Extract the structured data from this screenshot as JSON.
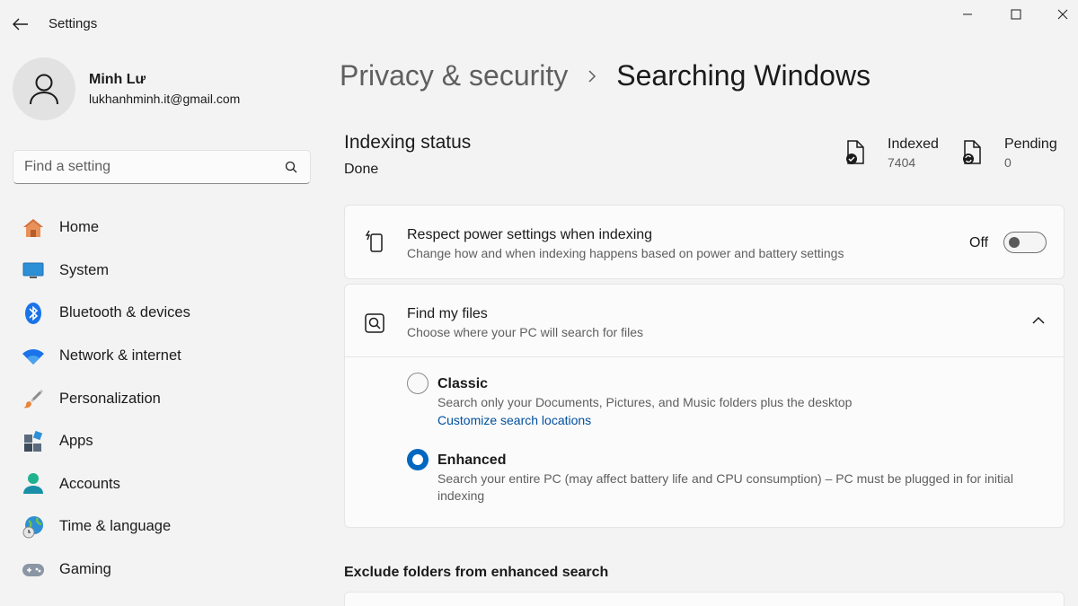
{
  "window": {
    "title": "Settings"
  },
  "profile": {
    "name": "Minh Lư",
    "email": "lukhanhminh.it@gmail.com"
  },
  "search": {
    "placeholder": "Find a setting"
  },
  "sidebar": {
    "items": [
      {
        "label": "Home",
        "icon": "home-icon"
      },
      {
        "label": "System",
        "icon": "system-icon"
      },
      {
        "label": "Bluetooth & devices",
        "icon": "bluetooth-icon"
      },
      {
        "label": "Network & internet",
        "icon": "wifi-icon"
      },
      {
        "label": "Personalization",
        "icon": "brush-icon"
      },
      {
        "label": "Apps",
        "icon": "apps-icon"
      },
      {
        "label": "Accounts",
        "icon": "accounts-icon"
      },
      {
        "label": "Time & language",
        "icon": "globe-clock-icon"
      },
      {
        "label": "Gaming",
        "icon": "gamepad-icon"
      }
    ]
  },
  "breadcrumb": {
    "parent": "Privacy & security",
    "current": "Searching Windows"
  },
  "indexing": {
    "title": "Indexing status",
    "status": "Done",
    "indexed_label": "Indexed",
    "indexed_count": "7404",
    "pending_label": "Pending",
    "pending_count": "0"
  },
  "power_setting": {
    "title": "Respect power settings when indexing",
    "description": "Change how and when indexing happens based on power and battery settings",
    "toggle_label": "Off",
    "enabled": false
  },
  "find_files": {
    "title": "Find my files",
    "description": "Choose where your PC will search for files",
    "classic": {
      "title": "Classic",
      "description": "Search only your Documents, Pictures, and Music folders plus the desktop",
      "link": "Customize search locations",
      "selected": false
    },
    "enhanced": {
      "title": "Enhanced",
      "description": "Search your entire PC (may affect battery life and CPU consumption) – PC must be plugged in for initial indexing",
      "selected": true
    }
  },
  "exclude": {
    "title": "Exclude folders from enhanced search"
  },
  "colors": {
    "accent": "#0067c0",
    "link": "#0050a0",
    "background": "#f3f3f3",
    "card": "#fbfbfb"
  }
}
